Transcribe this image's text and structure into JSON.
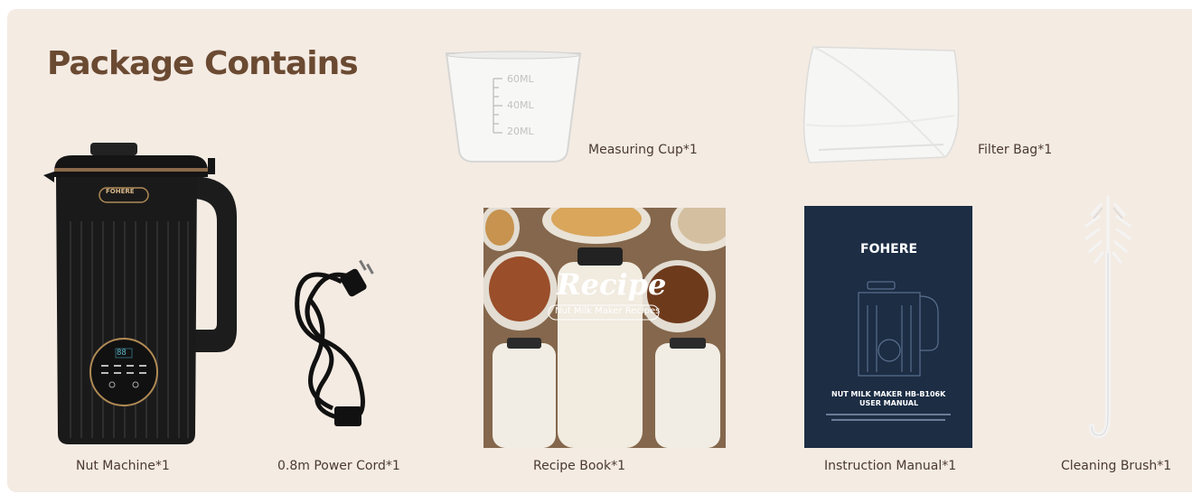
{
  "title": "Package Contains",
  "items": [
    {
      "id": "nut_machine",
      "caption": "Nut Machine*1",
      "brand": "FOHERE",
      "display": "88"
    },
    {
      "id": "power_cord",
      "caption": "0.8m Power Cord*1"
    },
    {
      "id": "recipe_book",
      "caption": "Recipe Book*1",
      "cover_title": "Recipe",
      "cover_subtitle": "Nut Milk Maker Recipes"
    },
    {
      "id": "instruction_manual",
      "caption": "Instruction Manual*1",
      "brand": "FOHERE",
      "heading": "NUT MILK MAKER HB-B106K",
      "subheading": "USER MANUAL"
    },
    {
      "id": "cleaning_brush",
      "caption": "Cleaning Brush*1"
    },
    {
      "id": "measuring_cup",
      "caption": "Measuring Cup*1",
      "marks": [
        "60ML",
        "40ML",
        "20ML"
      ]
    },
    {
      "id": "filter_bag",
      "caption": "Filter Bag*1"
    }
  ],
  "colors": {
    "background": "#f4ebe3",
    "title": "#6b4a32",
    "caption": "#4a3a30",
    "manual_cover": "#1c2d44",
    "machine_body": "#1a1a1a"
  }
}
